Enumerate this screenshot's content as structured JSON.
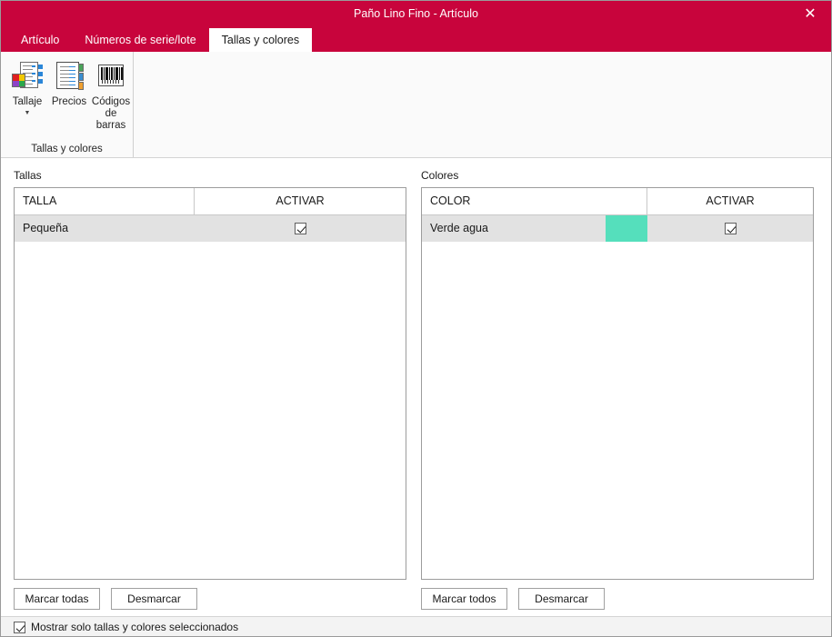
{
  "window": {
    "title": "Paño Lino Fino - Artículo",
    "close_label": "✕",
    "accent_color": "#c8043c"
  },
  "tabs": [
    {
      "label": "Artículo",
      "active": false
    },
    {
      "label": "Números de serie/lote",
      "active": false
    },
    {
      "label": "Tallas y colores",
      "active": true
    }
  ],
  "ribbon": {
    "group_title": "Tallas y colores",
    "buttons": [
      {
        "label": "Tallaje",
        "icon": "sizing-chart-icon",
        "has_dropdown": true
      },
      {
        "label": "Precios",
        "icon": "price-list-icon",
        "has_dropdown": false
      },
      {
        "label": "Códigos de barras",
        "icon": "barcode-icon",
        "has_dropdown": false
      }
    ]
  },
  "sizes_panel": {
    "caption": "Tallas",
    "columns": [
      "TALLA",
      "ACTIVAR"
    ],
    "rows": [
      {
        "name": "Pequeña",
        "active": true,
        "selected": true
      }
    ],
    "buttons": {
      "check_all": "Marcar todas",
      "uncheck_all": "Desmarcar"
    }
  },
  "colors_panel": {
    "caption": "Colores",
    "columns": [
      "COLOR",
      "ACTIVAR"
    ],
    "rows": [
      {
        "name": "Verde agua",
        "swatch": "#55dfbc",
        "active": true,
        "selected": true
      }
    ],
    "buttons": {
      "check_all": "Marcar todos",
      "uncheck_all": "Desmarcar"
    }
  },
  "footer": {
    "show_only_selected_label": "Mostrar solo tallas y colores seleccionados",
    "show_only_selected_checked": true
  }
}
